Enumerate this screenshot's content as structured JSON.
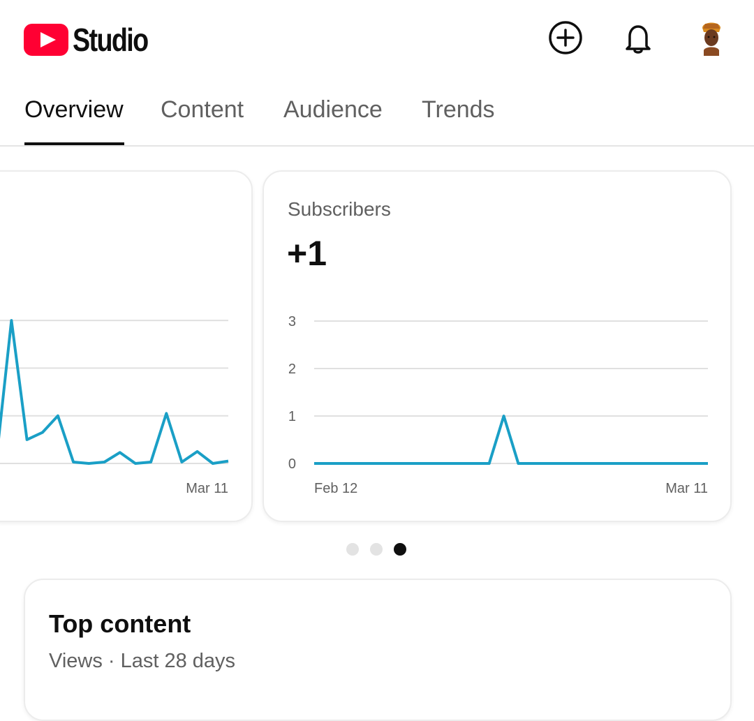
{
  "app": {
    "logo_text": "Studio"
  },
  "header": {
    "icons": [
      "create-plus-icon",
      "notifications-bell-icon",
      "account-avatar"
    ]
  },
  "tabs": [
    {
      "label": "Overview",
      "active": true
    },
    {
      "label": "Content",
      "active": false
    },
    {
      "label": "Audience",
      "active": false
    },
    {
      "label": "Trends",
      "active": false
    }
  ],
  "cards": {
    "left": {
      "x_end_label": "Mar 11",
      "chart_data": {
        "type": "line",
        "series": [
          {
            "values": [
              0,
              0,
              3,
              0.5,
              0.65,
              1,
              0.03,
              0,
              0.03,
              0.23,
              0,
              0.03,
              1.05,
              0.03,
              0.25,
              0,
              0.05
            ]
          }
        ],
        "x_end_label": "Mar 11",
        "ylim": [
          0,
          3.5
        ],
        "grid": true,
        "color": "#1a9fc6"
      }
    },
    "subscribers": {
      "title": "Subscribers",
      "value": "+1",
      "chart_data": {
        "type": "line",
        "x_start_label": "Feb 12",
        "x_end_label": "Mar 11",
        "yticks": [
          0,
          1,
          2,
          3
        ],
        "ylim": [
          0,
          3
        ],
        "grid": true,
        "color": "#1a9fc6",
        "series": [
          {
            "values": [
              0,
              0,
              0,
              0,
              0,
              0,
              0,
              0,
              0,
              0,
              0,
              0,
              0,
              1,
              0,
              0,
              0,
              0,
              0,
              0,
              0,
              0,
              0,
              0,
              0,
              0,
              0,
              0
            ]
          }
        ]
      }
    }
  },
  "carousel": {
    "count": 3,
    "active_index": 2
  },
  "top_content": {
    "title": "Top content",
    "subtitle": "Views · Last 28 days"
  }
}
